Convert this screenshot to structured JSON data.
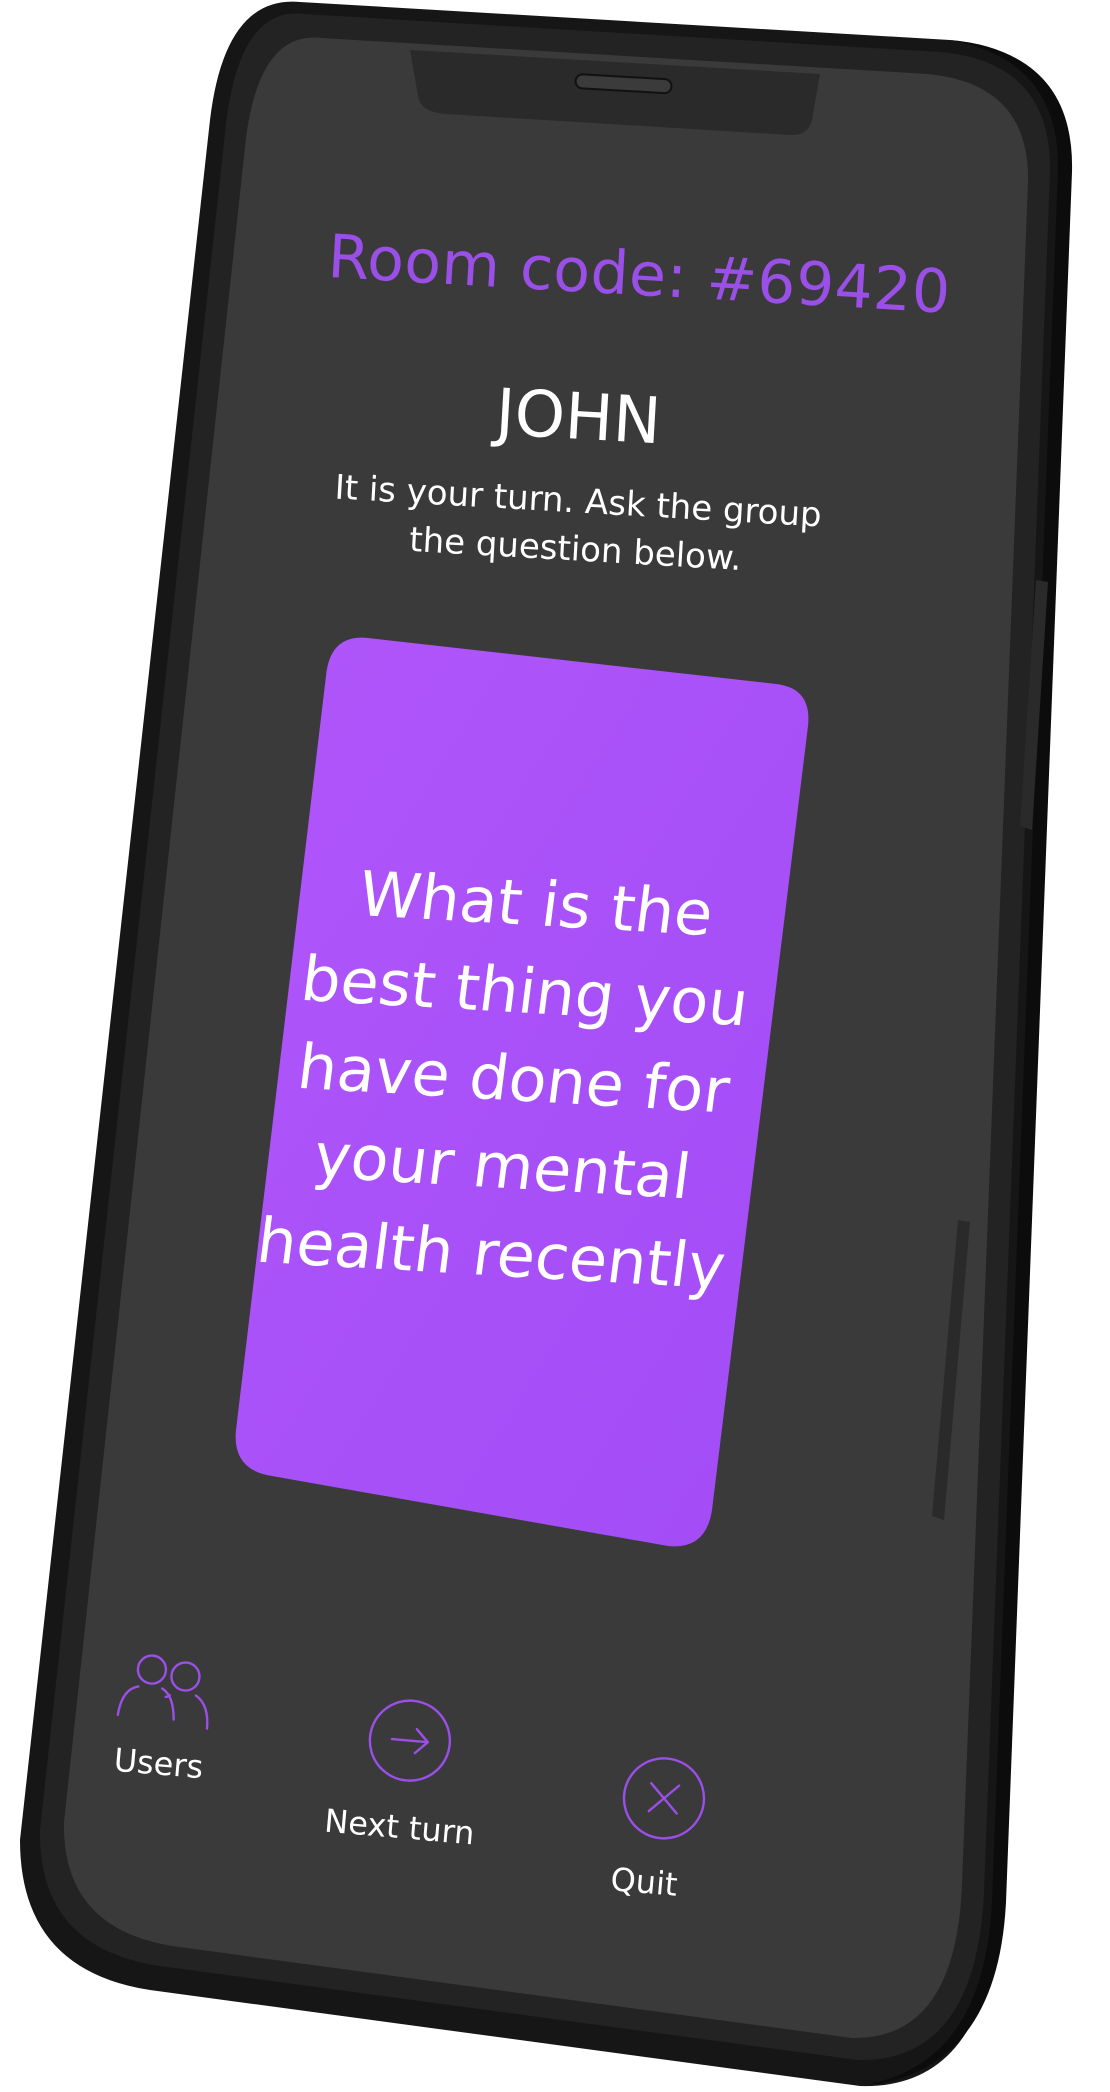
{
  "room": {
    "label": "Room code: #69420"
  },
  "player": {
    "name": "JOHN"
  },
  "instructions": {
    "text": "It is your turn. Ask the group the question below."
  },
  "card": {
    "question": "What is the best thing you have done for your mental health recently",
    "color": "#a64ff9"
  },
  "nav": {
    "users": {
      "label": "Users",
      "icon": "users-icon"
    },
    "next_turn": {
      "label": "Next turn",
      "icon": "arrow-right-icon"
    },
    "quit": {
      "label": "Quit",
      "icon": "close-icon"
    }
  },
  "colors": {
    "accent": "#9a4fe6",
    "screen_bg": "#3a3a3a",
    "phone_frame": "#1c1c1c"
  }
}
